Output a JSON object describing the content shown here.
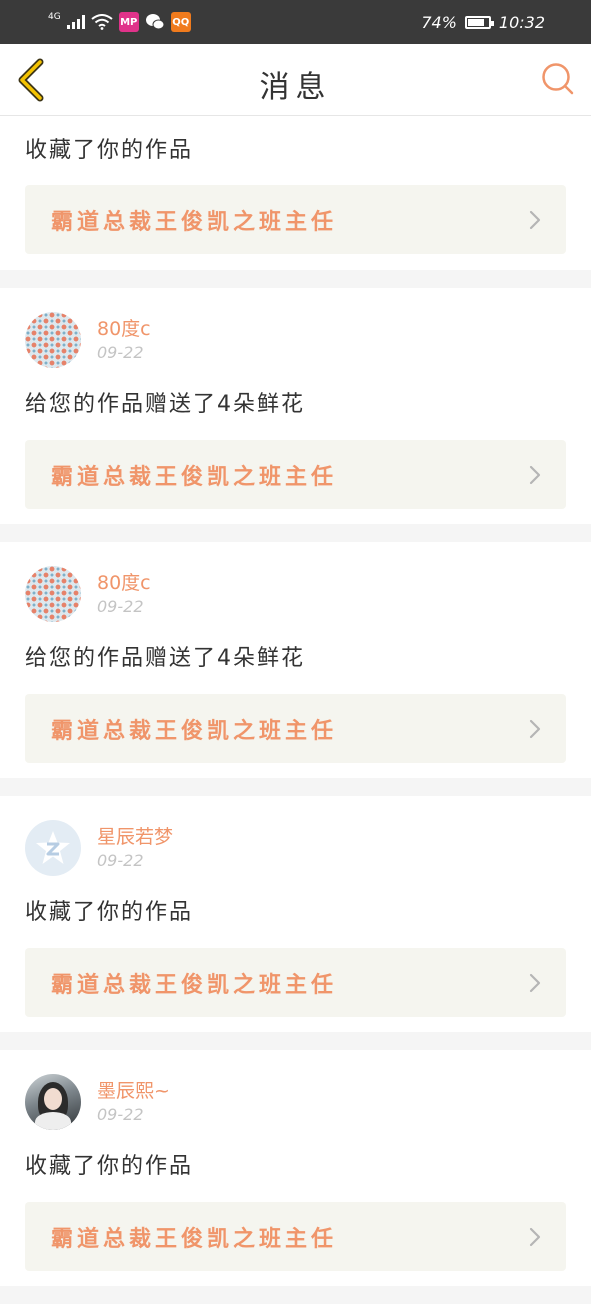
{
  "status_bar": {
    "network": "4G",
    "battery": "74%",
    "battery_level": 0.74,
    "time": "10:32",
    "app_icons": [
      {
        "name": "mp-app-icon",
        "label": "MP",
        "color": "#e0338a"
      },
      {
        "name": "wechat-icon",
        "label": "",
        "color": "#3a3a3a"
      },
      {
        "name": "orange-app-icon",
        "label": "QQ",
        "color": "#f07b1d"
      }
    ]
  },
  "header": {
    "title": "消息",
    "back_icon": "chevron-left-icon",
    "search_icon": "search-icon",
    "accent_color": "#f0956a"
  },
  "messages": [
    {
      "user": null,
      "action": "收藏了你的作品",
      "work_title": "霸道总裁王俊凯之班主任"
    },
    {
      "user": {
        "name": "80度c",
        "date": "09-22",
        "avatar": "dots"
      },
      "action": "给您的作品赠送了4朵鲜花",
      "work_title": "霸道总裁王俊凯之班主任"
    },
    {
      "user": {
        "name": "80度c",
        "date": "09-22",
        "avatar": "dots"
      },
      "action": "给您的作品赠送了4朵鲜花",
      "work_title": "霸道总裁王俊凯之班主任"
    },
    {
      "user": {
        "name": "星辰若梦",
        "date": "09-22",
        "avatar": "default-z"
      },
      "action": "收藏了你的作品",
      "work_title": "霸道总裁王俊凯之班主任"
    },
    {
      "user": {
        "name": "墨辰熙~",
        "date": "09-22",
        "avatar": "photo"
      },
      "action": "收藏了你的作品",
      "work_title": "霸道总裁王俊凯之班主任"
    }
  ]
}
